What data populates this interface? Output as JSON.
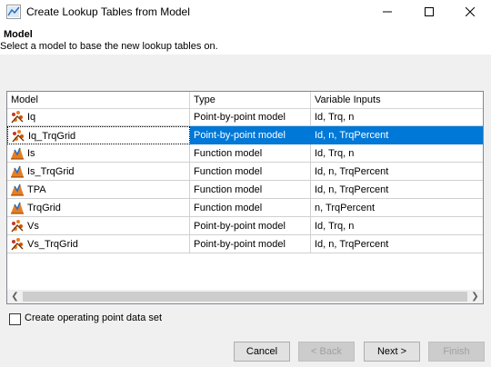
{
  "window": {
    "title": "Create Lookup Tables from Model"
  },
  "header": {
    "title": "Model",
    "subtitle": "Select a model to base the new lookup tables on."
  },
  "table": {
    "columns": [
      "Model",
      "Type",
      "Variable Inputs"
    ],
    "rows": [
      {
        "model": "Iq",
        "type": "Point-by-point model",
        "inputs": "Id, Trq, n",
        "icon": "point-by-point-model-icon"
      },
      {
        "model": "Iq_TrqGrid",
        "type": "Point-by-point model",
        "inputs": "Id, n, TrqPercent",
        "icon": "point-by-point-model-icon",
        "selected": true
      },
      {
        "model": "Is",
        "type": "Function model",
        "inputs": "Id, Trq, n",
        "icon": "function-model-icon"
      },
      {
        "model": "Is_TrqGrid",
        "type": "Function model",
        "inputs": "Id, n, TrqPercent",
        "icon": "function-model-icon"
      },
      {
        "model": "TPA",
        "type": "Function model",
        "inputs": "Id, n, TrqPercent",
        "icon": "function-model-icon"
      },
      {
        "model": "TrqGrid",
        "type": "Function model",
        "inputs": "n, TrqPercent",
        "icon": "function-model-icon"
      },
      {
        "model": "Vs",
        "type": "Point-by-point model",
        "inputs": "Id, Trq, n",
        "icon": "point-by-point-model-icon"
      },
      {
        "model": "Vs_TrqGrid",
        "type": "Point-by-point model",
        "inputs": "Id, n, TrqPercent",
        "icon": "point-by-point-model-icon"
      }
    ]
  },
  "options": {
    "checkbox_label": "Create operating point data set",
    "checked": false
  },
  "buttons": {
    "cancel": "Cancel",
    "back": "< Back",
    "next": "Next >",
    "finish": "Finish"
  },
  "colors": {
    "selection": "#0078d7",
    "background": "#f0f0f0"
  }
}
